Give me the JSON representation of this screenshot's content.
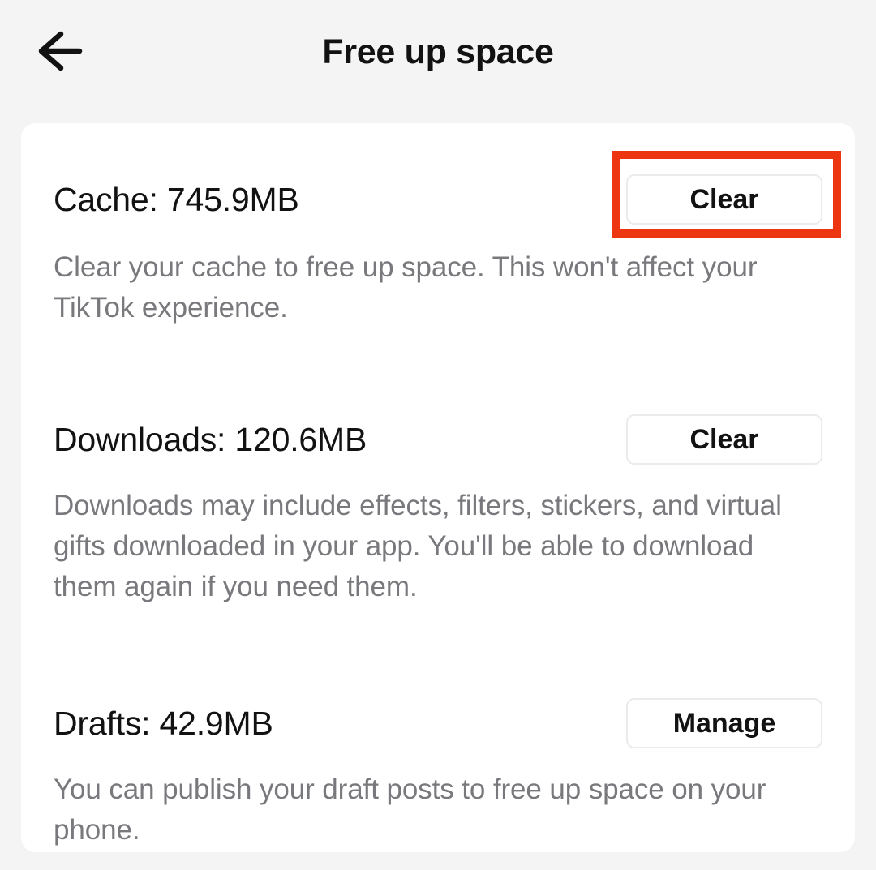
{
  "header": {
    "back_icon": "arrow-left-icon",
    "title": "Free up space"
  },
  "sections": [
    {
      "id": "cache",
      "title": "Cache: 745.9MB",
      "button_label": "Clear",
      "description": "Clear your cache to free up space. This won't affect your TikTok experience.",
      "highlighted": true
    },
    {
      "id": "downloads",
      "title": "Downloads: 120.6MB",
      "button_label": "Clear",
      "description": "Downloads may include effects, filters, stickers, and virtual gifts downloaded in your app. You'll be able to download them again if you need them.",
      "highlighted": false
    },
    {
      "id": "drafts",
      "title": "Drafts: 42.9MB",
      "button_label": "Manage",
      "description": "You can publish your draft posts to free up space on your phone.",
      "highlighted": false
    }
  ],
  "annotation": {
    "target": "cache-clear-button",
    "color": "#EE3511"
  },
  "colors": {
    "page_background": "#F4F4F4",
    "card_background": "#FFFFFF",
    "title_text": "#121212",
    "description_text": "#79797D",
    "button_border": "#EBEBEB",
    "highlight": "#EE3511"
  }
}
